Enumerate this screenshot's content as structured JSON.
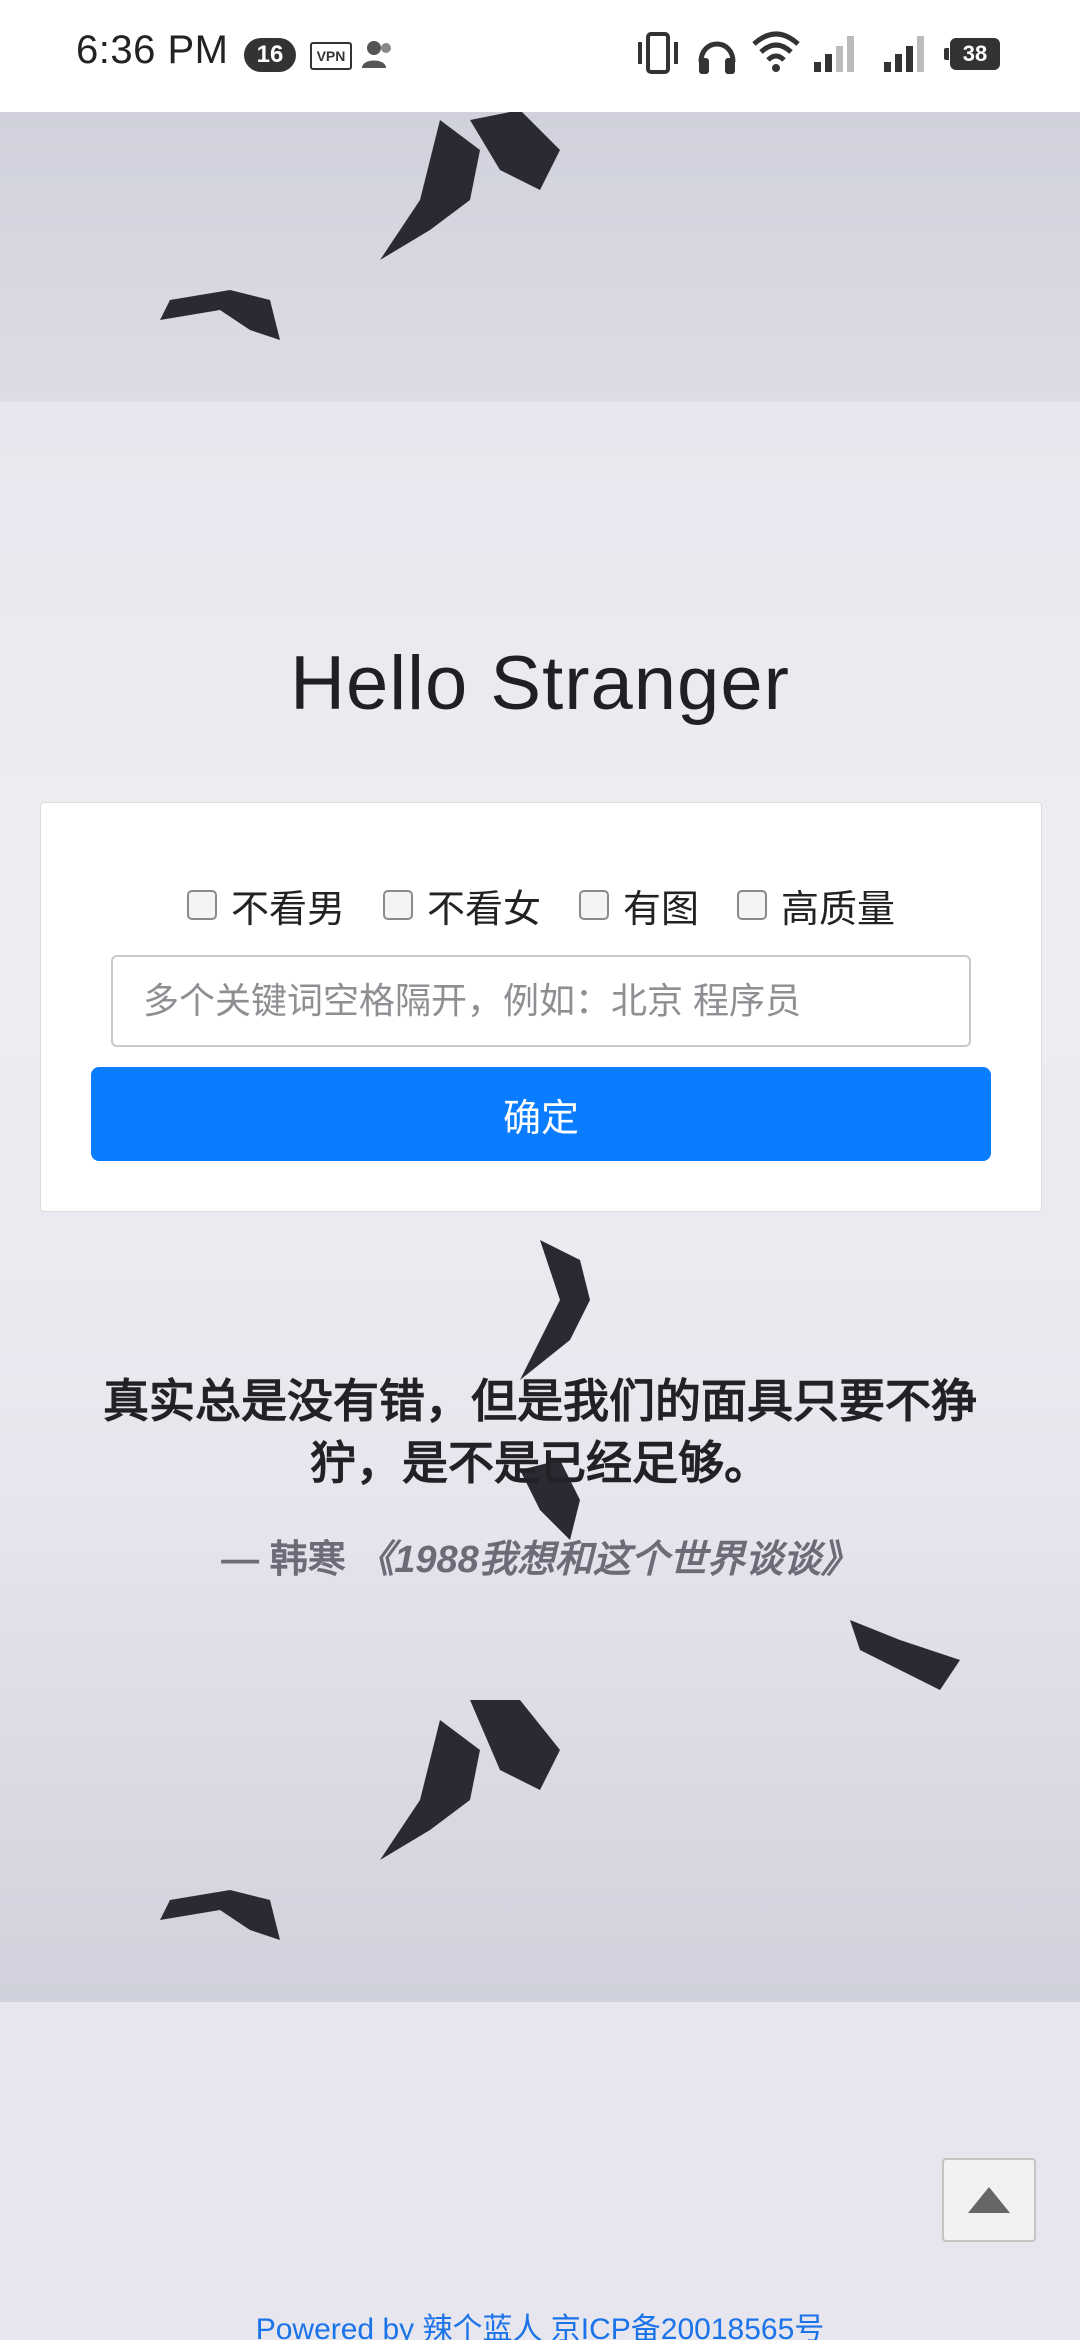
{
  "status_bar": {
    "time": "6:36 PM",
    "notification_count": "16",
    "vpn_label": "VPN",
    "battery": "38"
  },
  "page": {
    "title": "Hello Stranger"
  },
  "filters": [
    {
      "label": "不看男",
      "checked": false
    },
    {
      "label": "不看女",
      "checked": false
    },
    {
      "label": "有图",
      "checked": false
    },
    {
      "label": "高质量",
      "checked": false
    }
  ],
  "search": {
    "value": "",
    "placeholder": "多个关键词空格隔开，例如：北京 程序员"
  },
  "submit_label": "确定",
  "quote": {
    "text": "真实总是没有错，但是我们的面具只要不狰狞，是不是已经足够。",
    "author": "— 韩寒",
    "book": "《1988我想和这个世界谈谈》"
  },
  "footer": {
    "text": "Powered by 辣个蓝人 京ICP备20018565号"
  },
  "colors": {
    "primary_button": "#0a7cff",
    "footer_link": "#1a73e8"
  },
  "icons": {
    "back_to_top": "triangle-up-icon"
  }
}
